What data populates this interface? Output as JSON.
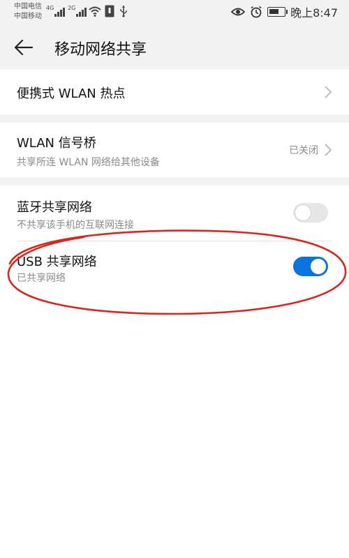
{
  "status_bar": {
    "carrier_1": "中国电信",
    "carrier_2": "中国移动",
    "sim1_network": "4G",
    "sim2_network": "2G",
    "time": "晚上8:47",
    "icons": [
      "signal-icon",
      "wifi-icon",
      "notification-icon",
      "usb-icon",
      "eye-icon",
      "alarm-icon",
      "battery-icon"
    ]
  },
  "header": {
    "title": "移动网络共享",
    "back_icon": "back-arrow-icon"
  },
  "items": {
    "hotspot": {
      "title": "便携式 WLAN 热点"
    },
    "wlan_bridge": {
      "title": "WLAN 信号桥",
      "subtitle": "共享所连 WLAN 网络给其他设备",
      "value": "已关闭"
    },
    "bluetooth": {
      "title": "蓝牙共享网络",
      "subtitle": "不共享该手机的互联网连接",
      "enabled": false
    },
    "usb": {
      "title": "USB 共享网络",
      "subtitle": "已共享网络",
      "enabled": true
    }
  },
  "colors": {
    "background": "#ffffff",
    "section_gap": "#f2f2f2",
    "toggle_on": "#0a74de",
    "toggle_off": "#e6e6e6",
    "annotation": "#d9261c",
    "secondary_text": "#8a8a8a"
  }
}
